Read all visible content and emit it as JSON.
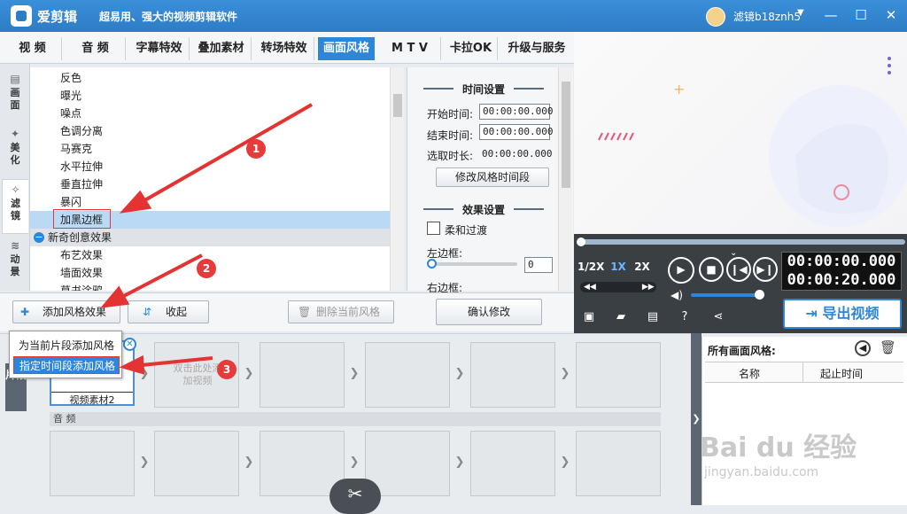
{
  "app": {
    "name": "爱剪辑",
    "slogan": "超易用、强大的视频剪辑软件",
    "username": "滤镜b18znh5"
  },
  "window": {
    "minimize": "—",
    "maximize": "☐",
    "close": "✕"
  },
  "tabs": [
    {
      "label": "视 频"
    },
    {
      "label": "音 频"
    },
    {
      "label": "字幕特效"
    },
    {
      "label": "叠加素材"
    },
    {
      "label": "转场特效"
    },
    {
      "label": "画面风格",
      "active": true
    },
    {
      "label": "M T V"
    },
    {
      "label": "卡拉OK"
    },
    {
      "label": "升级与服务"
    }
  ],
  "side_tabs": [
    {
      "label": "画面",
      "icon": "picture-icon"
    },
    {
      "label": "美化",
      "icon": "magic-wand-icon"
    },
    {
      "label": "滤镜",
      "icon": "filter-wand-icon",
      "active": true
    },
    {
      "label": "动景",
      "icon": "wave-icon"
    }
  ],
  "effects": [
    {
      "label": "反色"
    },
    {
      "label": "曝光"
    },
    {
      "label": "噪点"
    },
    {
      "label": "色调分离"
    },
    {
      "label": "马赛克"
    },
    {
      "label": "水平拉伸"
    },
    {
      "label": "垂直拉伸"
    },
    {
      "label": "暴闪"
    },
    {
      "label": "加黑边框",
      "selected": true
    },
    {
      "label": "新奇创意效果",
      "group": true
    },
    {
      "label": "布艺效果"
    },
    {
      "label": "墙面效果"
    },
    {
      "label": "草书涂鸦"
    }
  ],
  "settings": {
    "time_title": "时间设置",
    "start_label": "开始时间:",
    "start_value": "00:00:00.000",
    "end_label": "结束时间:",
    "end_value": "00:00:00.000",
    "duration_label": "选取时长:",
    "duration_value": "00:00:00.000",
    "modify_time_button": "修改风格时间段",
    "effect_title": "效果设置",
    "smooth_label": "柔和过渡",
    "left_border_label": "左边框:",
    "left_border_value": "0",
    "right_border_label": "右边框:",
    "confirm_button": "确认修改"
  },
  "toolbar": {
    "add_style": "添加风格效果",
    "collapse": "收起",
    "delete_style": "删除当前风格"
  },
  "popup": {
    "items": [
      {
        "label": "为当前片段添加风格"
      },
      {
        "label": "指定时间段添加风格",
        "selected": true
      }
    ]
  },
  "annotations": {
    "n1": "1",
    "n2": "2",
    "n3": "3"
  },
  "player": {
    "speeds": [
      "1/2X",
      "1X",
      "2X"
    ],
    "time_current": "00:00:00.000",
    "time_total": "00:00:20.000",
    "export": "导出视频"
  },
  "timeline": {
    "clip_label": "视频素材2",
    "empty_hint": "双击此处添加视频",
    "audio_label": "音 频",
    "side_label": "片段"
  },
  "style_panel": {
    "title": "所有画面风格:",
    "col_name": "名称",
    "col_time": "起止时间"
  },
  "watermark": {
    "logo": "Bai du 经验",
    "url": "jingyan.baidu.com"
  },
  "colors": {
    "accent": "#2e86d6",
    "highlight": "#e33333",
    "selected_row": "#b9d9f5"
  }
}
